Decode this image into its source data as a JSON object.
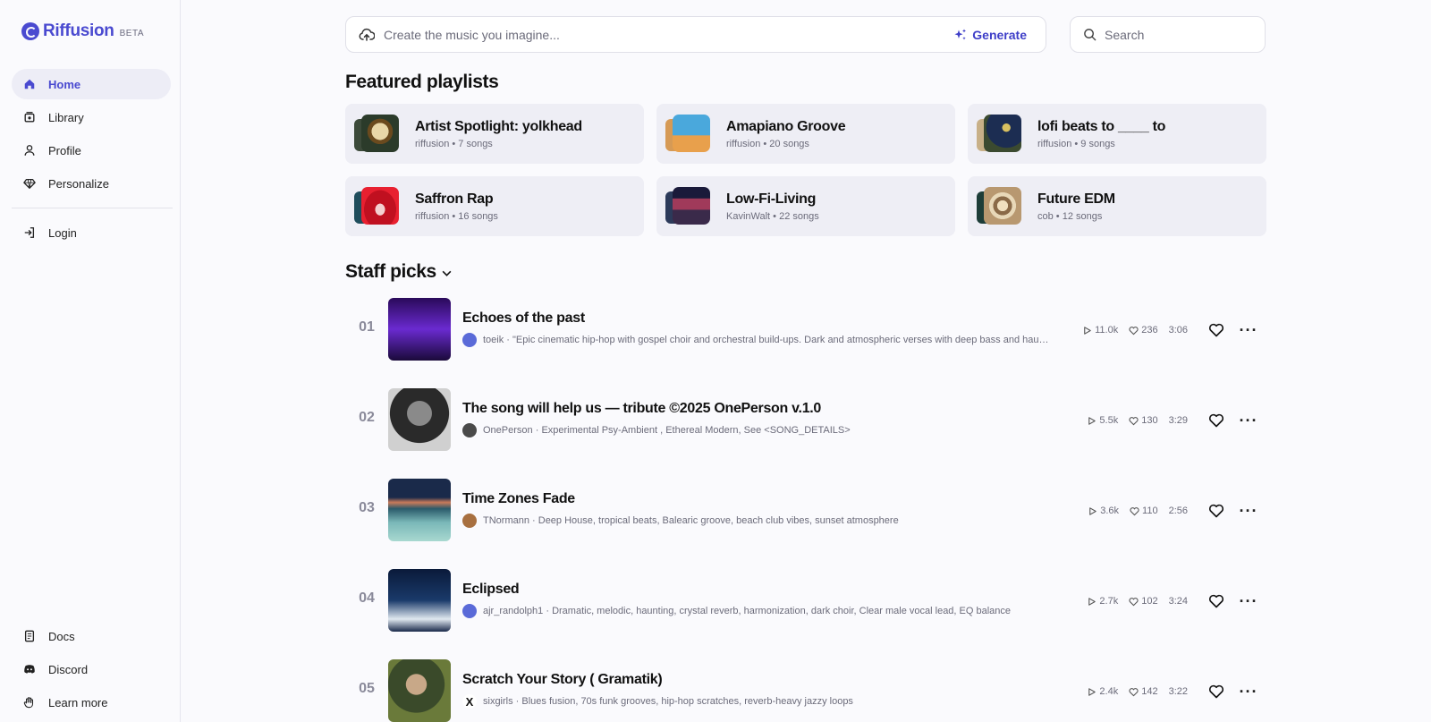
{
  "brand": {
    "name": "Riffusion",
    "badge": "BETA",
    "color": "#4a4ad0"
  },
  "sidebar": {
    "items": [
      {
        "label": "Home",
        "icon": "home-icon",
        "active": true
      },
      {
        "label": "Library",
        "icon": "library-icon"
      },
      {
        "label": "Profile",
        "icon": "profile-icon"
      },
      {
        "label": "Personalize",
        "icon": "diamond-icon"
      }
    ],
    "login": {
      "label": "Login",
      "icon": "login-icon"
    },
    "bottom": [
      {
        "label": "Docs",
        "icon": "docs-icon"
      },
      {
        "label": "Discord",
        "icon": "discord-icon"
      },
      {
        "label": "Learn more",
        "icon": "hand-icon"
      }
    ]
  },
  "create": {
    "placeholder": "Create the music you imagine...",
    "generate_label": "Generate"
  },
  "search": {
    "placeholder": "Search"
  },
  "featured": {
    "title": "Featured playlists",
    "playlists": [
      {
        "title": "Artist Spotlight: yolkhead",
        "meta": "riffusion • 7 songs"
      },
      {
        "title": "Amapiano Groove",
        "meta": "riffusion • 20 songs"
      },
      {
        "title": "lofi beats to ____ to",
        "meta": "riffusion • 9 songs"
      },
      {
        "title": "Saffron Rap",
        "meta": "riffusion • 16 songs"
      },
      {
        "title": "Low-Fi-Living",
        "meta": "KavinWalt • 22 songs"
      },
      {
        "title": "Future EDM",
        "meta": "cob • 12 songs"
      }
    ]
  },
  "staff_picks": {
    "title": "Staff picks",
    "tracks": [
      {
        "num": "01",
        "title": "Echoes of the past",
        "user": "toeik",
        "desc": "\"Epic cinematic hip-hop with gospel choir and orchestral build-ups. Dark and atmospheric verses with deep bass and haunt...",
        "plays": "11.0k",
        "likes": "236",
        "duration": "3:06"
      },
      {
        "num": "02",
        "title": "The song will help us — tribute ©2025 OnePerson v.1.0",
        "user": "OnePerson",
        "desc": "Experimental Psy-Ambient , Ethereal Modern, See <SONG_DETAILS>",
        "plays": "5.5k",
        "likes": "130",
        "duration": "3:29"
      },
      {
        "num": "03",
        "title": "Time Zones Fade",
        "user": "TNormann",
        "desc": "Deep House, tropical beats, Balearic groove, beach club vibes, sunset atmosphere",
        "plays": "3.6k",
        "likes": "110",
        "duration": "2:56"
      },
      {
        "num": "04",
        "title": "Eclipsed",
        "user": "ajr_randolph1",
        "desc": "Dramatic, melodic, haunting, crystal reverb, harmonization, dark choir, Clear male vocal lead, EQ balance",
        "plays": "2.7k",
        "likes": "102",
        "duration": "3:24"
      },
      {
        "num": "05",
        "title": "Scratch Your Story ( Gramatik)",
        "user": "sixgirls",
        "desc": "Blues fusion, 70s funk grooves, hip-hop scratches, reverb-heavy jazzy loops",
        "plays": "2.4k",
        "likes": "142",
        "duration": "3:22"
      }
    ]
  }
}
